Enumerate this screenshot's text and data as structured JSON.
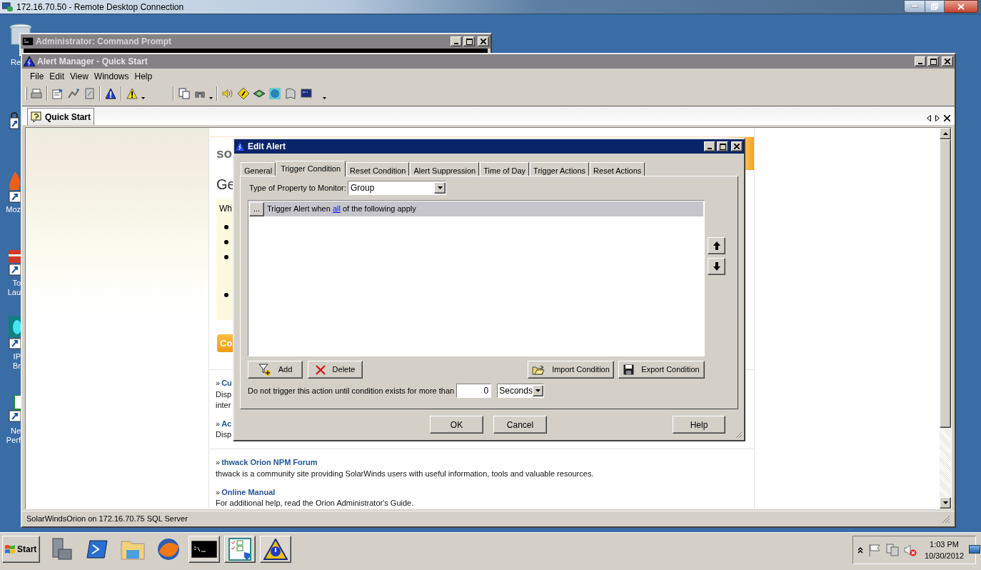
{
  "remote_desktop": {
    "title": "172.16.70.50 - Remote Desktop Connection"
  },
  "desktop_icons": [
    {
      "lines": [
        "Re"
      ]
    },
    {
      "lines": [
        "Moz"
      ]
    },
    {
      "lines": [
        "To",
        "Lau"
      ]
    },
    {
      "lines": [
        "IP",
        "Br"
      ]
    },
    {
      "lines": [
        "Ne",
        "Perf"
      ]
    }
  ],
  "command_prompt": {
    "title": "Administrator: Command Prompt"
  },
  "alert_manager": {
    "title": "Alert Manager - Quick Start",
    "menu": [
      "File",
      "Edit",
      "View",
      "Windows",
      "Help"
    ],
    "doc_tabs": [
      {
        "label": "Quick Start",
        "selected": true
      }
    ],
    "status_bar": "SolarWindsOrion on 172.16.70.75 SQL Server"
  },
  "page": {
    "logo": "so",
    "heading": "Ge",
    "intro": "Wh",
    "button": "Co",
    "links": [
      {
        "marker": "»",
        "title": "Cu",
        "lines": [
          "Disp",
          "inter"
        ]
      },
      {
        "marker": "»",
        "title": "Ac",
        "lines": [
          "Disp"
        ]
      },
      {
        "marker": "»",
        "title": "thwack Orion NPM Forum",
        "lines": [
          "thwack is a community site providing SolarWinds users with useful information, tools and valuable resources."
        ]
      },
      {
        "marker": "»",
        "title": "Online Manual",
        "lines": [
          "For additional help, read the Orion Administrator's Guide."
        ]
      }
    ]
  },
  "dialog": {
    "title": "Edit Alert",
    "tabs": [
      {
        "label": "General",
        "selected": false
      },
      {
        "label": "Trigger Condition",
        "selected": true
      },
      {
        "label": "Reset Condition",
        "selected": false
      },
      {
        "label": "Alert Suppression",
        "selected": false
      },
      {
        "label": "Time of Day",
        "selected": false
      },
      {
        "label": "Trigger Actions",
        "selected": false
      },
      {
        "label": "Reset Actions",
        "selected": false
      }
    ],
    "property_label": "Type of Property to Monitor:",
    "property_value": "Group",
    "condition": {
      "button": "...",
      "before": "Trigger Alert when",
      "link": "all",
      "after": "of the following apply"
    },
    "left_buttons": [
      {
        "kind": "add",
        "label": "Add"
      },
      {
        "kind": "delete",
        "label": "Delete"
      }
    ],
    "right_buttons": [
      {
        "kind": "import",
        "label": "Import Condition"
      },
      {
        "kind": "export",
        "label": "Export Condition"
      }
    ],
    "delay_label": "Do not trigger this action until condition exists for more than",
    "delay_value": "0",
    "delay_unit": "Seconds",
    "footer_buttons": [
      "OK",
      "Cancel",
      "Help"
    ]
  },
  "taskbar": {
    "start": "Start",
    "buttons": [
      {
        "running": false
      },
      {
        "running": false
      },
      {
        "running": false
      },
      {
        "running": false
      },
      {
        "running": true
      },
      {
        "running": true
      },
      {
        "running": true
      }
    ],
    "time": "1:03 PM",
    "date": "10/30/2012"
  }
}
